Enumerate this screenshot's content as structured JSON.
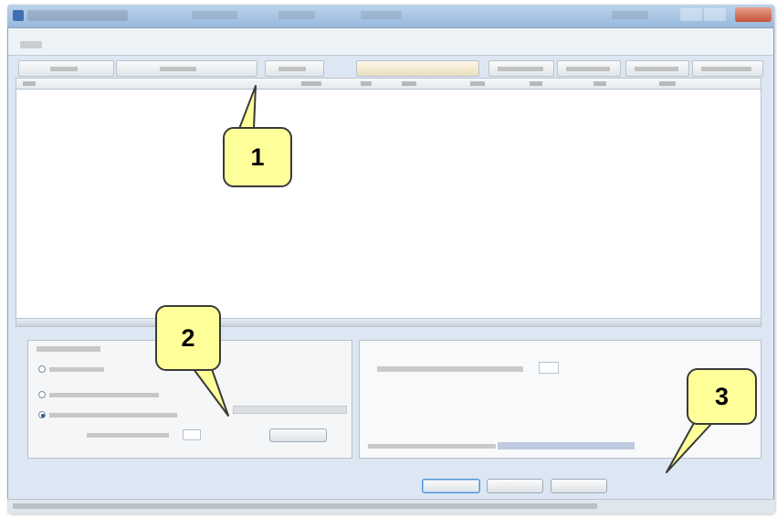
{
  "callouts": {
    "one": "1",
    "two": "2",
    "three": "3"
  },
  "colors": {
    "callout_fill": "#ffff99",
    "callout_border": "#3a3a3a",
    "window_chrome": "#dce7f3",
    "titlebar": "#98b9dd"
  },
  "icons": {
    "app": "app-icon",
    "minimize": "minimize-icon",
    "maximize": "maximize-icon",
    "close": "close-icon"
  }
}
